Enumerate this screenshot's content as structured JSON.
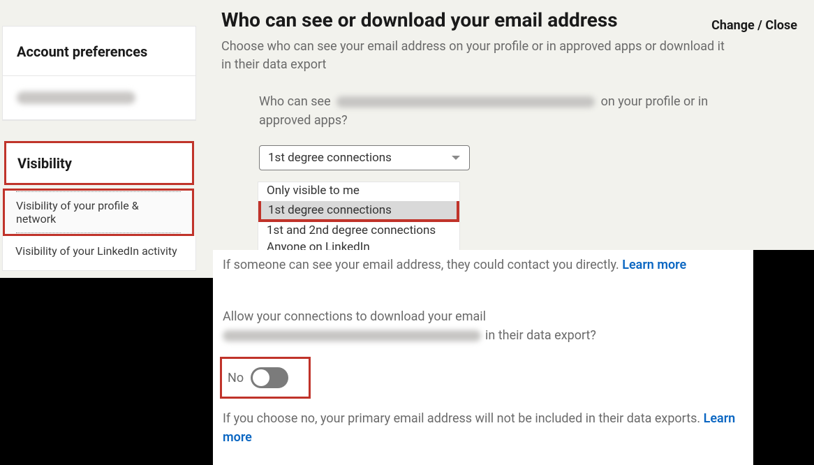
{
  "sidebar": {
    "account_preferences": "Account preferences",
    "visibility": "Visibility",
    "items": {
      "profile_network": "Visibility of your profile & network",
      "activity": "Visibility of your LinkedIn activity"
    }
  },
  "main": {
    "title": "Who can see or download your email address",
    "change_close": "Change / Close",
    "subtitle": "Choose who can see your email address on your profile or in approved apps or download it in their data export",
    "who_can_see_prefix": "Who can see",
    "who_can_see_suffix": "on your profile or in approved apps?",
    "select_value": "1st degree connections",
    "dropdown": {
      "only_me": "Only visible to me",
      "first": "1st degree connections",
      "first_second": "1st and 2nd degree connections",
      "anyone": "Anyone on LinkedIn"
    },
    "info1_text": "If someone can see your email address, they could contact you directly. ",
    "learn_more": "Learn more",
    "allow_prefix": "Allow your connections to download your email",
    "allow_suffix": "in their data export?",
    "toggle_label": "No",
    "info2_text": "If you choose no, your primary email address will not be included in their data exports. "
  }
}
